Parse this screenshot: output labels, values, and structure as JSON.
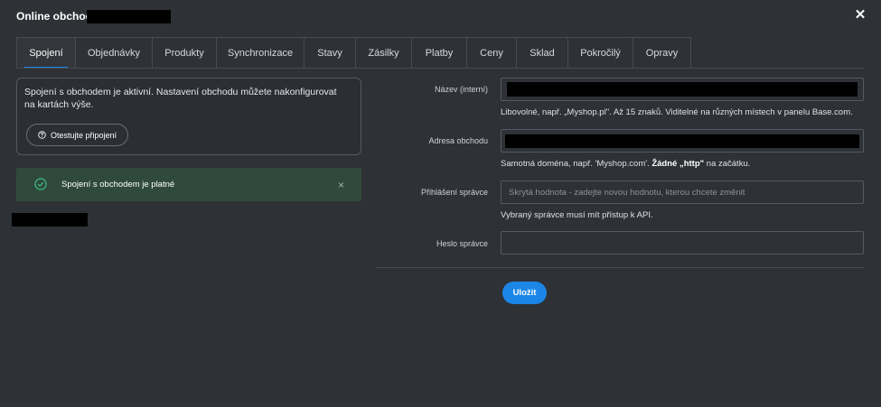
{
  "window": {
    "title": "Online obchod",
    "close_icon": "close-icon"
  },
  "tabs": [
    {
      "label": "Spojení",
      "active": true
    },
    {
      "label": "Objednávky"
    },
    {
      "label": "Produkty"
    },
    {
      "label": "Synchronizace"
    },
    {
      "label": "Stavy"
    },
    {
      "label": "Zásilky"
    },
    {
      "label": "Platby"
    },
    {
      "label": "Ceny"
    },
    {
      "label": "Sklad"
    },
    {
      "label": "Pokročilý"
    },
    {
      "label": "Opravy"
    }
  ],
  "info": {
    "text": "Spojení s obchodem je aktivní. Nastavení obchodu můžete nakonfigurovat na kartách výše.",
    "test_button": "Otestujte připojení"
  },
  "success": {
    "text": "Spojení s obchodem je platné",
    "close": "×"
  },
  "form": {
    "name_label": "Název (interní)",
    "name_help": "Libovolné, např. „Myshop.pl\". Až 15 znaků. Viditelné na různých místech v panelu Base.com.",
    "address_label": "Adresa obchodu",
    "address_help_prefix": "Samotná doména, např. 'Myshop.com'.",
    "address_help_bold": "Žádné „http\"",
    "address_help_suffix": "na začátku.",
    "admin_login_label": "Přihlášení správce",
    "admin_login_placeholder": "Skrytá hodnota - zadejte novou hodnotu, kterou chcete změnit",
    "admin_login_help": "Vybraný správce musí mít přístup k API.",
    "admin_password_label": "Heslo správce",
    "admin_password_value": "",
    "save_label": "Uložit"
  },
  "colors": {
    "accent": "#1c86e6",
    "background": "#2e3136",
    "success_bg": "#2f4a3d",
    "success_icon": "#3fbf7f"
  }
}
